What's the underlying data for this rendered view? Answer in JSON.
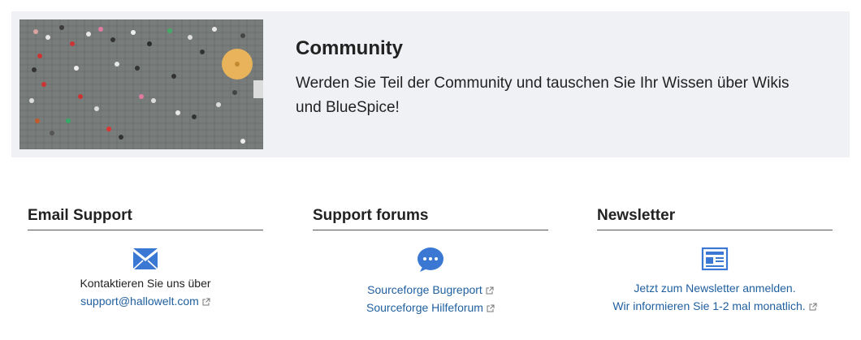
{
  "community": {
    "title": "Community",
    "description": "Werden Sie Teil der Community und tauschen Sie Ihr Wissen über Wikis und BlueSpice!"
  },
  "columns": {
    "email": {
      "title": "Email Support",
      "icon": "envelope-icon",
      "text": "Kontaktieren Sie uns über",
      "link": "support@hallowelt.com"
    },
    "forums": {
      "title": "Support forums",
      "icon": "chat-bubble-icon",
      "links": [
        "Sourceforge Bugreport",
        "Sourceforge Hilfeforum"
      ]
    },
    "newsletter": {
      "title": "Newsletter",
      "icon": "newspaper-icon",
      "lines": [
        "Jetzt zum Newsletter anmelden.",
        "Wir informieren Sie 1-2 mal monatlich."
      ]
    }
  },
  "colors": {
    "accent": "#3a78d4",
    "link": "#1f5f9f",
    "banner_bg": "#f0f1f5"
  }
}
